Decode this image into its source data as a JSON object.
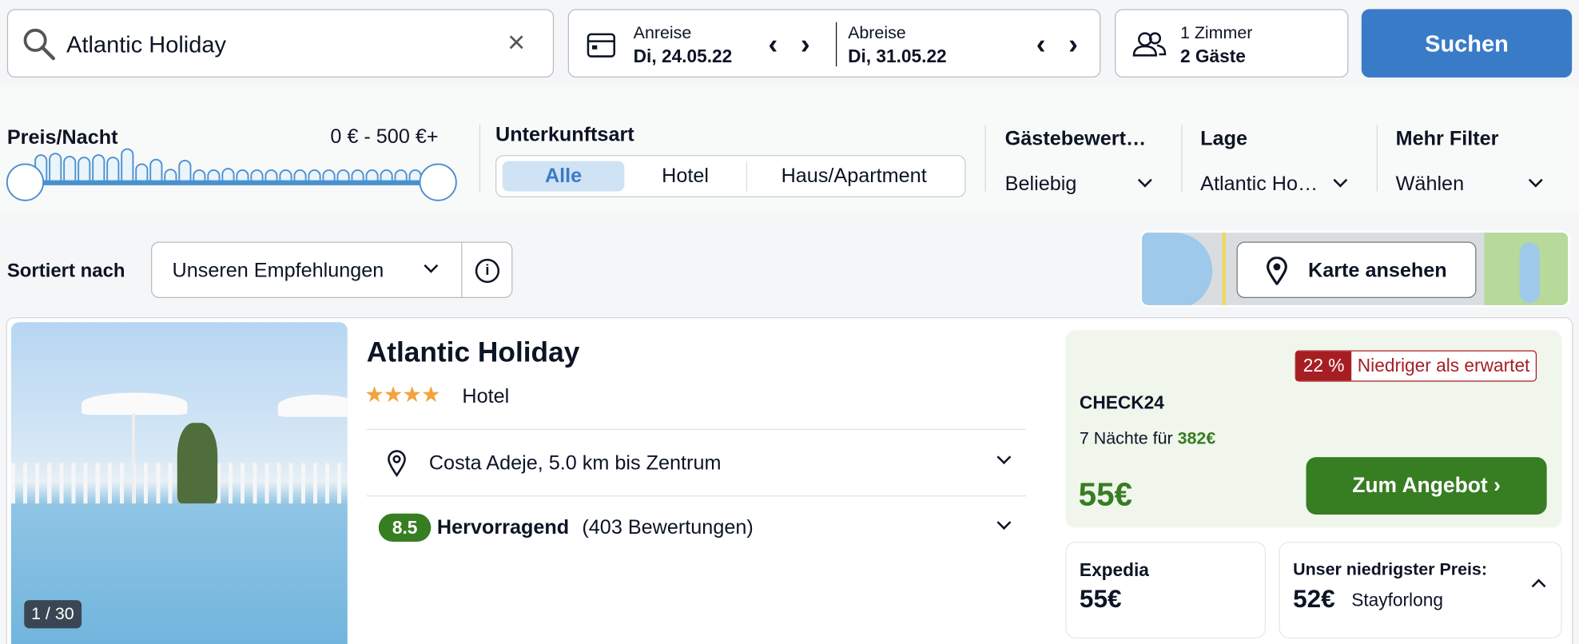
{
  "search": {
    "value": "Atlantic Holiday"
  },
  "dates": {
    "arrival_label": "Anreise",
    "arrival_value": "Di, 24.05.22",
    "departure_label": "Abreise",
    "departure_value": "Di, 31.05.22"
  },
  "guests": {
    "rooms": "1 Zimmer",
    "guests": "2 Gäste"
  },
  "search_button": "Suchen",
  "price_filter": {
    "label": "Preis/Nacht",
    "range": "0 € - 500 €+",
    "histogram_levels": [
      0.6,
      0.65,
      0.55,
      0.52,
      0.6,
      0.52,
      0.8,
      0.3,
      0.45,
      0.12,
      0.42,
      0.1,
      0.1,
      0.15,
      0.1,
      0.1,
      0.1,
      0.1,
      0.1,
      0.1,
      0.1,
      0.1,
      0.1,
      0.1,
      0.1,
      0.1,
      0.1
    ],
    "min_fraction": 0,
    "max_fraction": 1
  },
  "type_filter": {
    "label": "Unterkunftsart",
    "options": [
      "Alle",
      "Hotel",
      "Haus/Apartment"
    ],
    "selected": "Alle"
  },
  "rating_filter": {
    "label": "Gästebewert…",
    "value": "Beliebig"
  },
  "location_filter": {
    "label": "Lage",
    "value": "Atlantic Ho…"
  },
  "more_filter": {
    "label": "Mehr Filter",
    "value": "Wählen"
  },
  "sort": {
    "label": "Sortiert nach",
    "value": "Unseren Empfehlungen"
  },
  "map_button": "Karte ansehen",
  "hotel": {
    "name": "Atlantic Holiday",
    "stars": 4,
    "type": "Hotel",
    "location": "Costa Adeje, 5.0 km bis Zentrum",
    "score": "8.5",
    "rating_word": "Hervorragend",
    "reviews": "(403 Bewertungen)",
    "image_counter": "1 / 30",
    "offer": {
      "badge_pct": "22 %",
      "badge_text": "Niedriger als erwartet",
      "provider": "CHECK24",
      "nights_text": "7 Nächte für",
      "total": "382€",
      "price": "55€",
      "cta": "Zum Angebot"
    },
    "alt1": {
      "provider": "Expedia",
      "price": "55€"
    },
    "alt2": {
      "label": "Unser niedrigster Preis:",
      "price": "52€",
      "provider": "Stayforlong"
    }
  },
  "colors": {
    "primary": "#3a7bc8",
    "green": "#377d22",
    "red": "#a61e22",
    "star": "#f2a33a"
  }
}
